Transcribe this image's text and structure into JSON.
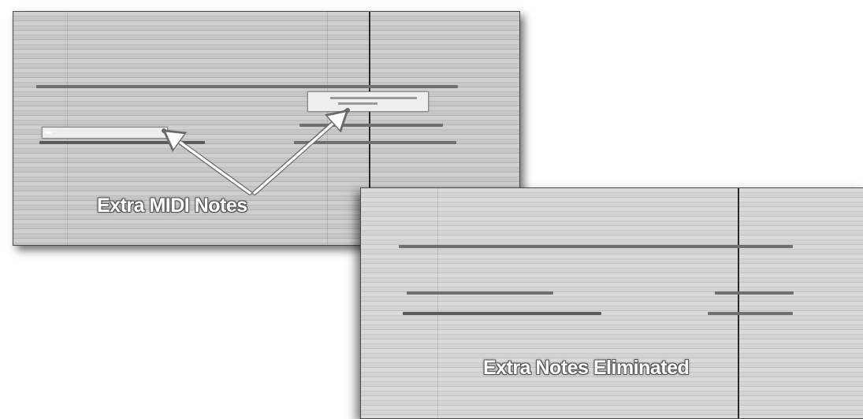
{
  "top_panel": {
    "caption": "Extra MIDI Notes"
  },
  "bottom_panel": {
    "caption": "Extra Notes Eliminated"
  },
  "colors": {
    "note": "#6f6f6f",
    "highlight": "#eeeeee",
    "playhead": "#2a2a2a",
    "caption_text": "#ffffff"
  }
}
